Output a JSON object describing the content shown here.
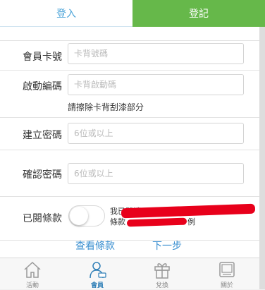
{
  "tabs": {
    "login": "登入",
    "register": "登記"
  },
  "form": {
    "card_number": {
      "label": "會員卡號",
      "placeholder": "卡背號碼"
    },
    "activation_code": {
      "label": "啟動編碼",
      "placeholder": "卡背啟動碼",
      "hint": "請擦除卡背刮漆部分"
    },
    "password": {
      "label": "建立密碼",
      "placeholder": "6位或以上"
    },
    "confirm_password": {
      "label": "確認密碼",
      "placeholder": "6位或以上"
    },
    "terms": {
      "label": "已閱條款",
      "text_line1": "我已閱讀",
      "text_line2": "條款",
      "text_line2_end": "例",
      "checked": false
    }
  },
  "links": {
    "view_terms": "查看條款",
    "next_step": "下一步"
  },
  "bottom_nav": [
    {
      "label": "活動",
      "icon": "home-icon",
      "active": false
    },
    {
      "label": "會員",
      "icon": "member-icon",
      "active": true
    },
    {
      "label": "兌換",
      "icon": "gift-icon",
      "active": false
    },
    {
      "label": "關於",
      "icon": "about-icon",
      "active": false
    }
  ],
  "colors": {
    "accent_blue": "#4aa3d8",
    "register_green": "#66b84a",
    "redaction_red": "#e8001b"
  }
}
